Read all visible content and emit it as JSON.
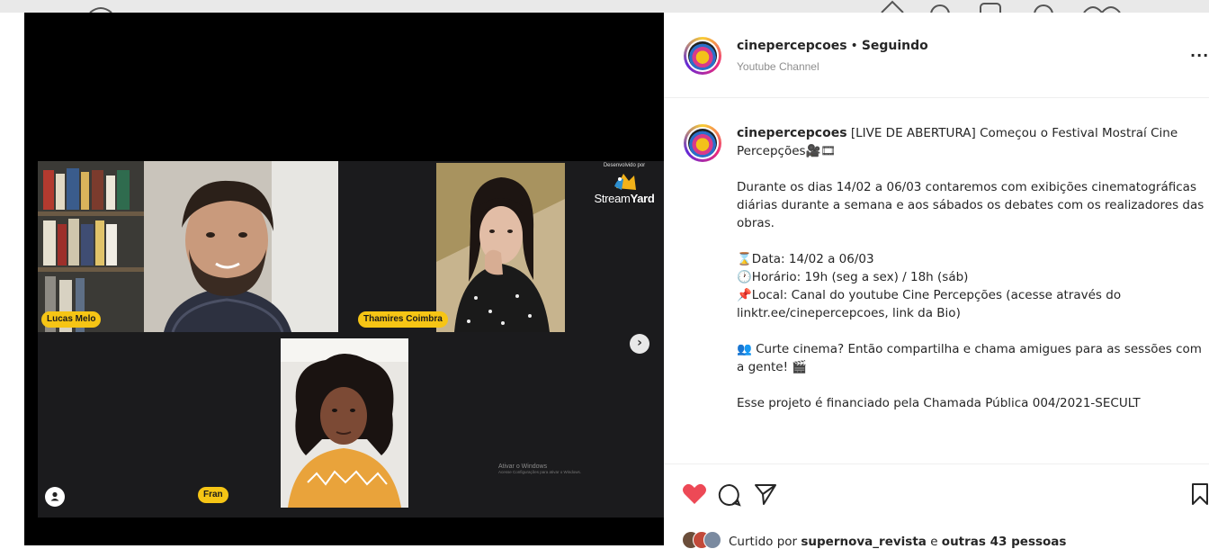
{
  "video": {
    "participants": [
      {
        "name": "Lucas Melo"
      },
      {
        "name": "Thamires Coimbra"
      },
      {
        "name": "Fran"
      }
    ],
    "branding": {
      "small_text": "Desenvolvido por",
      "name_light": "Stream",
      "name_bold": "Yard"
    },
    "watermark": {
      "line1": "Ativar o Windows",
      "line2": "Acesse Configurações para ativar o Windows."
    }
  },
  "post": {
    "author": "cinepercepcoes",
    "separator": "•",
    "follow_status": "Seguindo",
    "subtitle": "Youtube Channel",
    "more": "...",
    "caption": {
      "username": "cinepercepcoes",
      "title": "[LIVE DE ABERTURA] Começou o Festival Mostraí Cine Percepções🎥🎞",
      "p1": "Durante os dias 14/02 a 06/03 contaremos com exibições cinematográficas diárias durante a semana e aos sábados os debates com os realizadores das obras.",
      "date": "⌛Data: 14/02 a 06/03",
      "time": "🕐Horário: 19h (seg a sex) / 18h (sáb)",
      "place": "📌Local: Canal do youtube Cine Percepções (acesse através do linktr.ee/cinepercepcoes, link da Bio)",
      "p3": "👥 Curte cinema? Então compartilha e chama amigues para as sessões com a gente! 🎬",
      "p4": "Esse projeto é financiado pela Chamada Pública 004/2021-SECULT"
    },
    "likes": {
      "prefix": "Curtido por",
      "user": "supernova_revista",
      "middle": "e",
      "rest": "outras 43 pessoas"
    },
    "colors": {
      "heart": "#ed4956",
      "tag": "#f6c515"
    }
  }
}
